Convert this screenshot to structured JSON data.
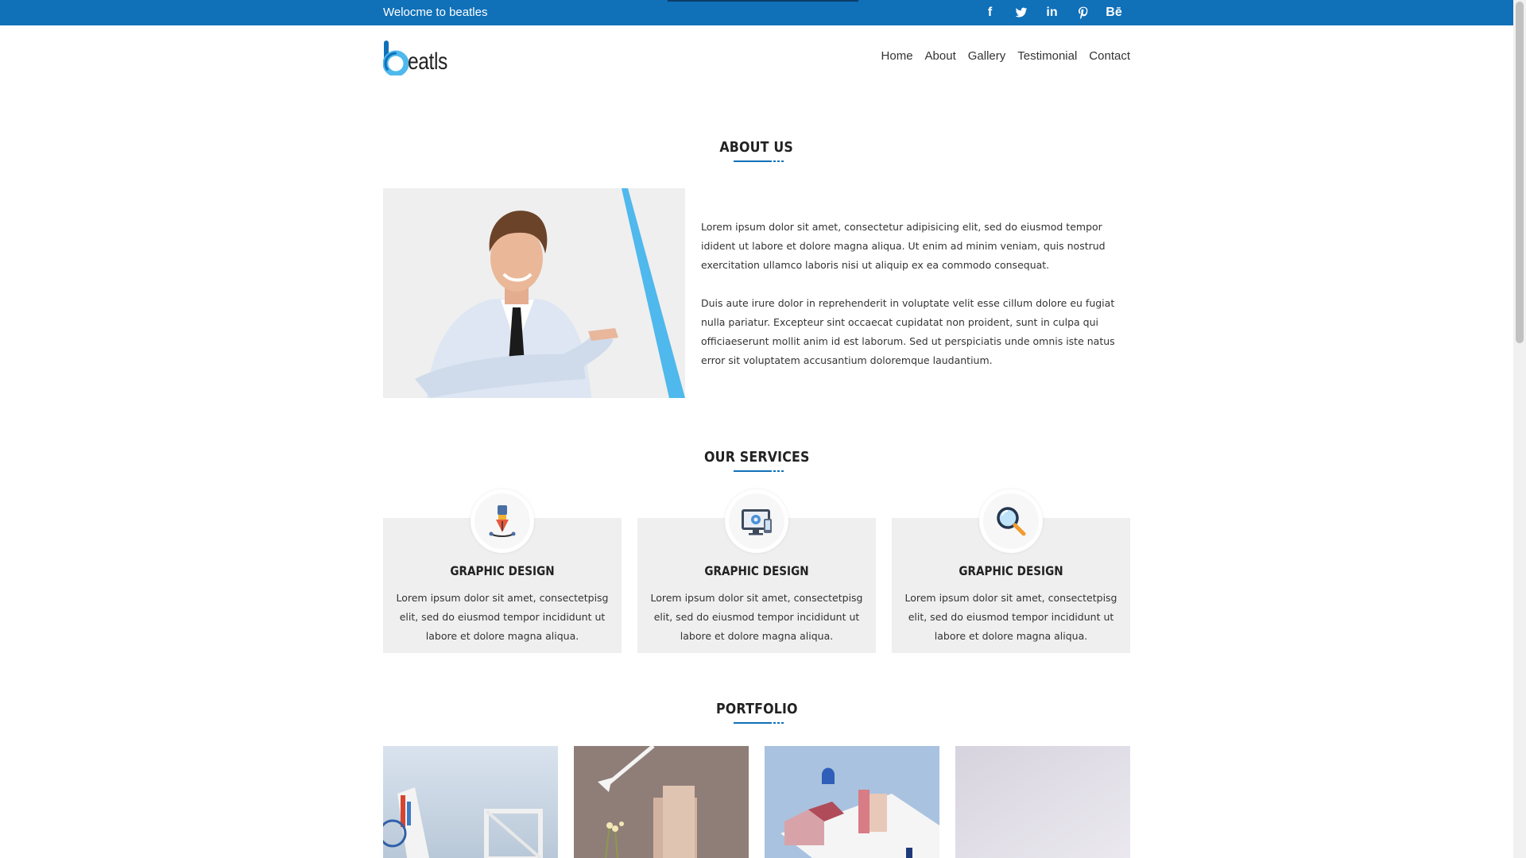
{
  "topbar": {
    "welcome_text": "Welocme to beatles",
    "social": [
      {
        "icon": "facebook-icon",
        "glyph": "f"
      },
      {
        "icon": "twitter-icon",
        "glyph": ""
      },
      {
        "icon": "linkedin-icon",
        "glyph": "in"
      },
      {
        "icon": "pinterest-icon",
        "glyph": ""
      },
      {
        "icon": "behance-icon",
        "glyph": "Bē"
      }
    ]
  },
  "header": {
    "logo_text": "eatls",
    "nav": [
      "Home",
      "About",
      "Gallery",
      "Testimonial",
      "Contact"
    ]
  },
  "about": {
    "title": "ABOUT US",
    "paragraphs": [
      "Lorem ipsum dolor sit amet, consectetur adipisicing elit, sed do eiusmod tempor idident ut labore et dolore magna aliqua. Ut enim ad minim veniam, quis nostrud exercitation ullamco laboris nisi ut aliquip ex ea commodo consequat.",
      "Duis aute irure dolor in reprehenderit in voluptate velit esse cillum dolore eu fugiat nulla pariatur. Excepteur sint occaecat cupidatat non proident, sunt in culpa qui officiaeserunt mollit anim id est laborum. Sed ut perspiciatis unde omnis iste natus error sit voluptatem accusantium doloremque laudantium."
    ]
  },
  "services": {
    "title": "OUR SERVICES",
    "items": [
      {
        "icon": "pen-tool-icon",
        "title": "GRAPHIC DESIGN",
        "text": "Lorem ipsum dolor sit amet, consectetpisg elit, sed do eiusmod tempor incididunt ut labore et dolore magna aliqua."
      },
      {
        "icon": "monitor-gear-icon",
        "title": "GRAPHIC DESIGN",
        "text": "Lorem ipsum dolor sit amet, consectetpisg elit, sed do eiusmod tempor incididunt ut labore et dolore magna aliqua."
      },
      {
        "icon": "magnifier-icon",
        "title": "GRAPHIC DESIGN",
        "text": "Lorem ipsum dolor sit amet, consectetpisg elit, sed do eiusmod tempor incididunt ut labore et dolore magna aliqua."
      }
    ]
  },
  "portfolio": {
    "title": "PORTFOLIO"
  },
  "colors": {
    "brand_blue": "#1070b8",
    "accent_cyan": "#4fb8ec",
    "card_gray": "#efefef"
  }
}
